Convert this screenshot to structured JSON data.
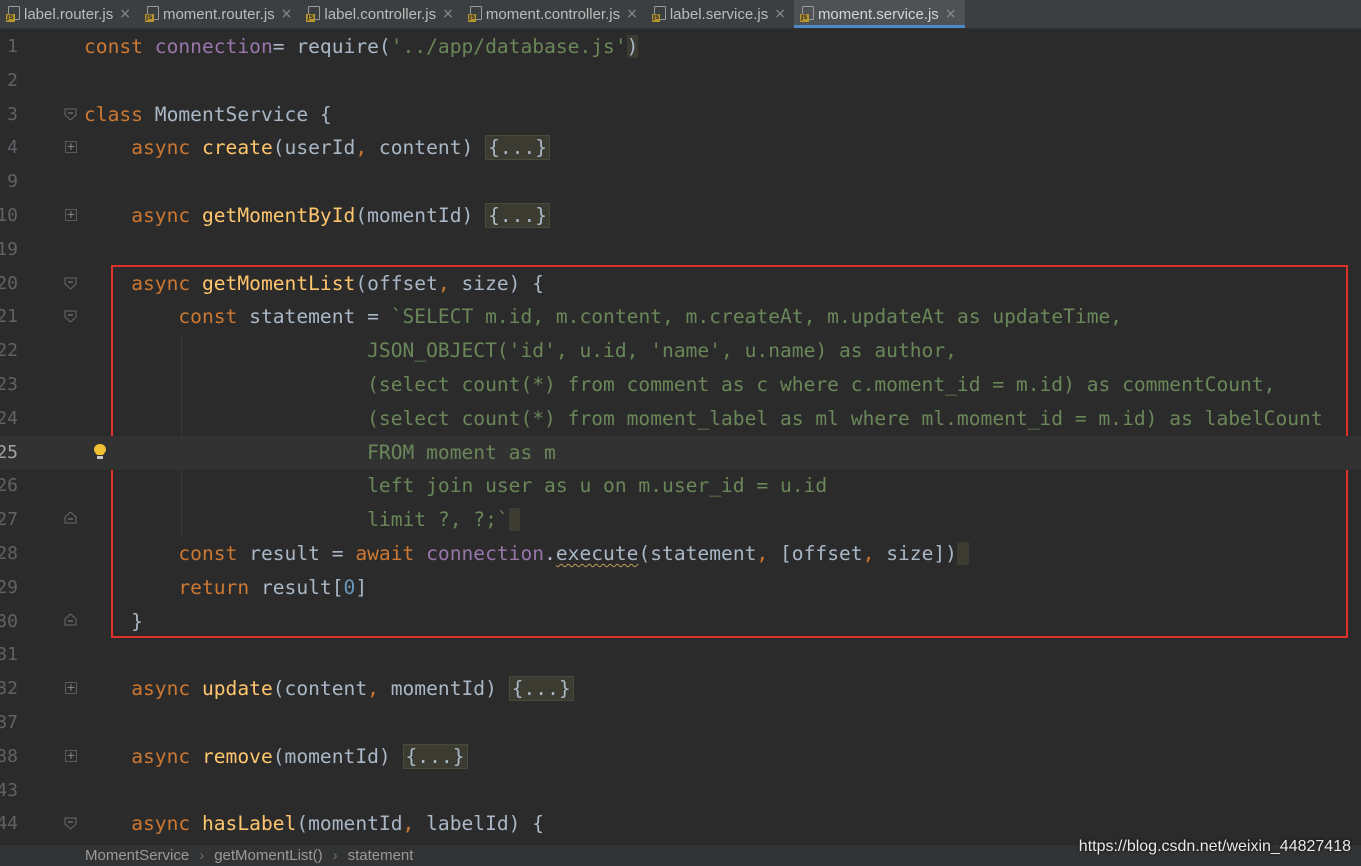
{
  "tabs": [
    {
      "label": "label.router.js",
      "badge": "JS",
      "active": false
    },
    {
      "label": "moment.router.js",
      "badge": "JS",
      "active": false
    },
    {
      "label": "label.controller.js",
      "badge": "JS",
      "active": false
    },
    {
      "label": "moment.controller.js",
      "badge": "JS",
      "active": false
    },
    {
      "label": "label.service.js",
      "badge": "JS",
      "active": false
    },
    {
      "label": "moment.service.js",
      "badge": "JS",
      "active": true
    }
  ],
  "tab_close_glyph": "×",
  "editor": {
    "current_line": "25",
    "lines": [
      {
        "num": "1",
        "tokens": [
          [
            "kw",
            "const "
          ],
          [
            "glob",
            "connection"
          ],
          [
            "",
            "= require("
          ],
          [
            "str",
            "'../app/database.js'"
          ],
          [
            "brace",
            ")"
          ]
        ]
      },
      {
        "num": "2",
        "tokens": []
      },
      {
        "num": "3",
        "tokens": [
          [
            "kw",
            "class "
          ],
          [
            "",
            "MomentService {"
          ]
        ]
      },
      {
        "num": "4",
        "tokens": [
          [
            "",
            "    "
          ],
          [
            "kw",
            "async "
          ],
          [
            "fn",
            "create"
          ],
          [
            "",
            "(userId"
          ],
          [
            "kw",
            ", "
          ],
          [
            "",
            "content) "
          ],
          [
            "ph",
            "{...}"
          ]
        ]
      },
      {
        "num": "9",
        "tokens": []
      },
      {
        "num": "10",
        "tokens": [
          [
            "",
            "    "
          ],
          [
            "kw",
            "async "
          ],
          [
            "fn",
            "getMomentById"
          ],
          [
            "",
            "(momentId) "
          ],
          [
            "ph",
            "{...}"
          ]
        ]
      },
      {
        "num": "19",
        "tokens": []
      },
      {
        "num": "20",
        "tokens": [
          [
            "",
            "    "
          ],
          [
            "kw",
            "async "
          ],
          [
            "fn",
            "getMomentList"
          ],
          [
            "",
            "(offset"
          ],
          [
            "kw",
            ", "
          ],
          [
            "",
            "size) {"
          ]
        ]
      },
      {
        "num": "21",
        "tokens": [
          [
            "",
            "        "
          ],
          [
            "kw",
            "const "
          ],
          [
            "",
            "statement = "
          ],
          [
            "str",
            "`SELECT m.id, m.content, m.createAt, m.updateAt as updateTime,"
          ]
        ]
      },
      {
        "num": "22",
        "tokens": [
          [
            "str",
            "                        JSON_OBJECT('id', u.id, 'name', u.name) as author,"
          ]
        ]
      },
      {
        "num": "23",
        "tokens": [
          [
            "str",
            "                        (select count(*) from comment as c where c.moment_id = m.id) as commentCount,"
          ]
        ]
      },
      {
        "num": "24",
        "tokens": [
          [
            "str",
            "                        (select count(*) from moment_label as ml where ml.moment_id = m.id) as labelCount"
          ]
        ]
      },
      {
        "num": "25",
        "tokens": [
          [
            "str",
            "                        FROM moment as m"
          ]
        ]
      },
      {
        "num": "26",
        "tokens": [
          [
            "str",
            "                        left join user as u on m.user_id = u.id"
          ]
        ]
      },
      {
        "num": "27",
        "tokens": [
          [
            "str",
            "                        limit ?, ?;`"
          ],
          [
            "brace",
            " "
          ]
        ]
      },
      {
        "num": "28",
        "tokens": [
          [
            "",
            "        "
          ],
          [
            "kw",
            "const "
          ],
          [
            "",
            "result = "
          ],
          [
            "kw",
            "await "
          ],
          [
            "glob",
            "connection"
          ],
          [
            "",
            "."
          ],
          [
            "sq",
            "execute"
          ],
          [
            "",
            "(statement"
          ],
          [
            "kw",
            ", "
          ],
          [
            "",
            "[offset"
          ],
          [
            "kw",
            ", "
          ],
          [
            "",
            "size])"
          ],
          [
            "brace",
            " "
          ]
        ]
      },
      {
        "num": "29",
        "tokens": [
          [
            "",
            "        "
          ],
          [
            "kw",
            "return "
          ],
          [
            "",
            "result["
          ],
          [
            "num",
            "0"
          ],
          [
            "",
            "]"
          ]
        ]
      },
      {
        "num": "30",
        "tokens": [
          [
            "",
            "    }"
          ]
        ]
      },
      {
        "num": "31",
        "tokens": []
      },
      {
        "num": "32",
        "tokens": [
          [
            "",
            "    "
          ],
          [
            "kw",
            "async "
          ],
          [
            "fn",
            "update"
          ],
          [
            "",
            "(content"
          ],
          [
            "kw",
            ", "
          ],
          [
            "",
            "momentId) "
          ],
          [
            "ph",
            "{...}"
          ]
        ]
      },
      {
        "num": "37",
        "tokens": []
      },
      {
        "num": "38",
        "tokens": [
          [
            "",
            "    "
          ],
          [
            "kw",
            "async "
          ],
          [
            "fn",
            "remove"
          ],
          [
            "",
            "(momentId) "
          ],
          [
            "ph",
            "{...}"
          ]
        ]
      },
      {
        "num": "43",
        "tokens": []
      },
      {
        "num": "44",
        "tokens": [
          [
            "",
            "    "
          ],
          [
            "kw",
            "async "
          ],
          [
            "fn",
            "hasLabel"
          ],
          [
            "",
            "(momentId"
          ],
          [
            "kw",
            ", "
          ],
          [
            "",
            "labelId) {"
          ]
        ]
      }
    ]
  },
  "gutter_markers": {
    "3": "fold-open",
    "4": "fold-plus",
    "10": "fold-plus",
    "20": "fold-open",
    "21": "fold-open",
    "25": "bulb",
    "27": "fold-close",
    "30": "fold-close",
    "32": "fold-plus",
    "38": "fold-plus",
    "44": "fold-open"
  },
  "breadcrumb": [
    "MomentService",
    "getMomentList()",
    "statement"
  ],
  "watermark": "https://blog.csdn.net/weixin_44827418",
  "colors": {
    "background": "#2b2b2b",
    "keyword": "#cc7832",
    "string": "#6a8759",
    "function": "#ffc66d",
    "global": "#9876aa",
    "number": "#6897bb",
    "highlight_box": "#e0312d",
    "active_tab_underline": "#4a88c7"
  }
}
